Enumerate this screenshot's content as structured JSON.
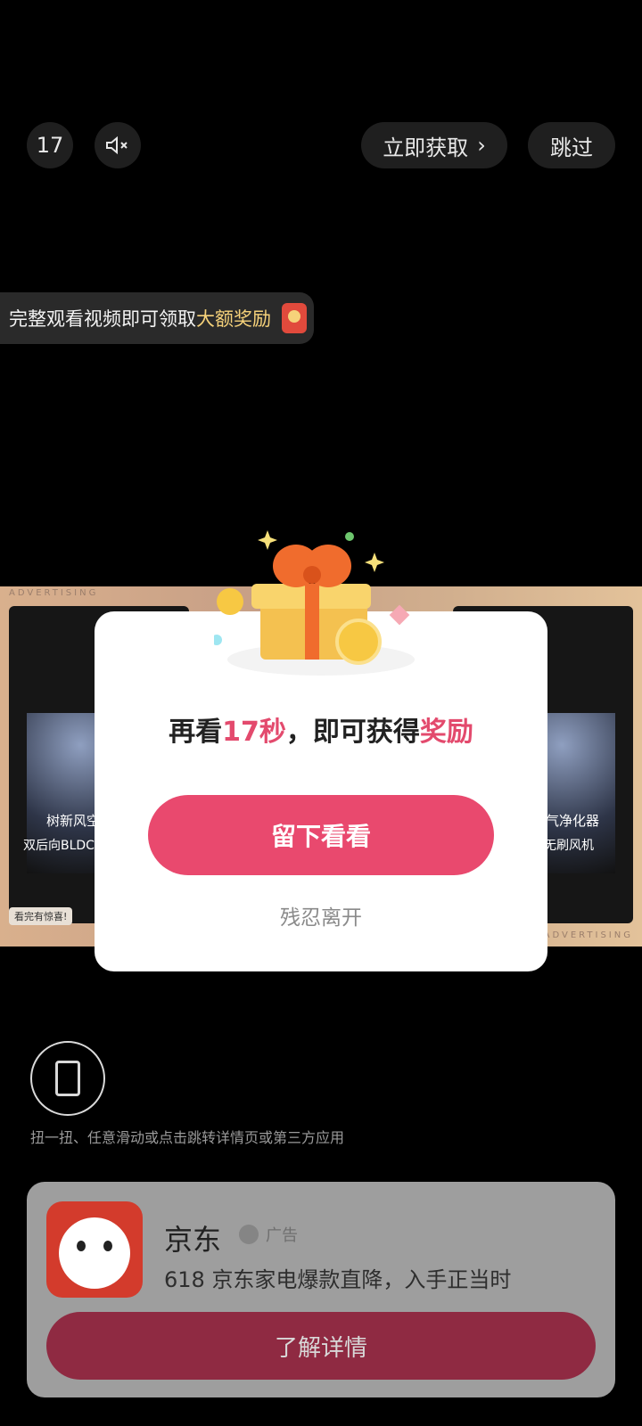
{
  "top": {
    "countdown": "17",
    "get_now": "立即获取",
    "skip": "跳过"
  },
  "reward_tip": {
    "text_prefix": "完整观看视频即可领取",
    "text_highlight": "大额奖励"
  },
  "ad_preview": {
    "left_title": "树新风空",
    "left_subtitle": "双后向BLDC高",
    "left_badge": "看完有惊喜!",
    "right_title": "气净化器",
    "right_subtitle": "无刷风机",
    "stripe_text": "ADVERTISING"
  },
  "modal": {
    "msg_part1": "再看",
    "msg_part2": "17秒",
    "msg_part3": "，即可获得",
    "msg_part4": "奖励",
    "stay_button": "留下看看",
    "leave": "残忍离开"
  },
  "hint": "扭一扭、任意滑动或点击跳转详情页或第三方应用",
  "app_card": {
    "name": "京东",
    "ad_label": "广告",
    "description": "618 京东家电爆款直降，入手正当时",
    "detail_button": "了解详情"
  },
  "colors": {
    "accent": "#e9496e",
    "highlight": "#f6d27a",
    "background": "#000000"
  }
}
